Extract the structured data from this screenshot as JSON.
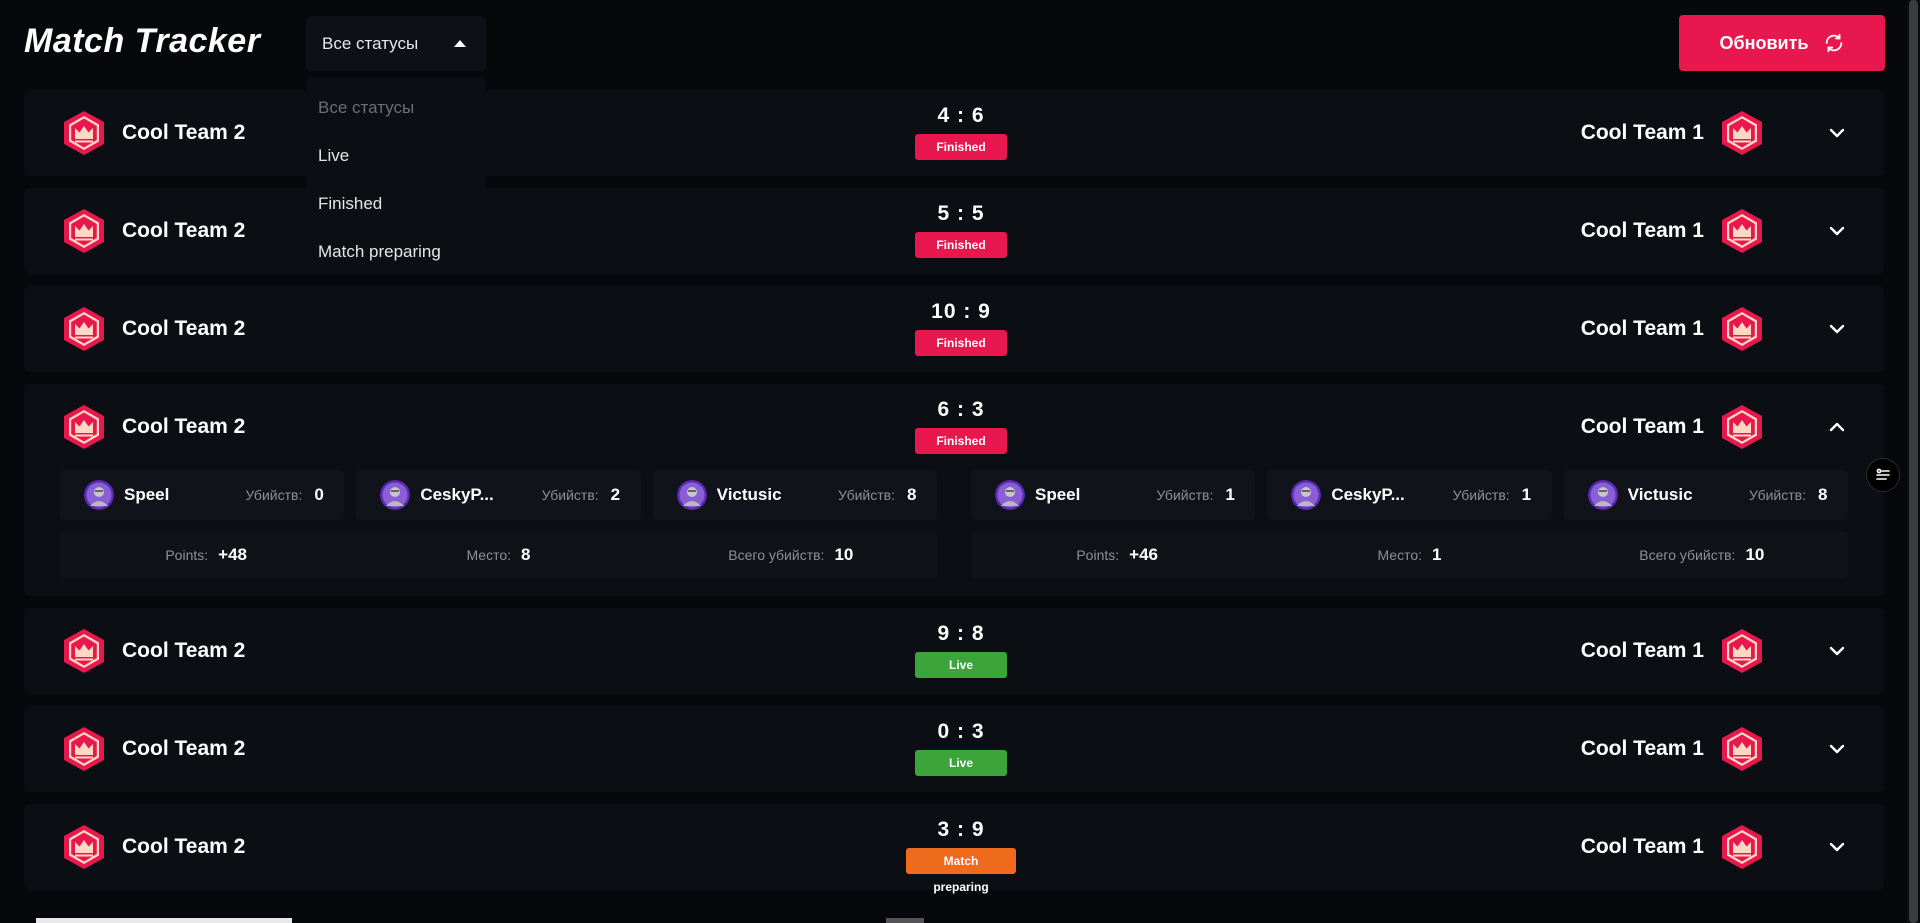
{
  "app": {
    "title": "Match Tracker"
  },
  "filter": {
    "selected": "Все статусы",
    "options": [
      "Все статусы",
      "Live",
      "Finished",
      "Match preparing"
    ]
  },
  "refresh": {
    "label": "Обновить"
  },
  "colors": {
    "accent": "#e8184e",
    "live": "#3ba53b",
    "preparing": "#ee6a1c",
    "background": "#06080c",
    "card": "#0b0e13"
  },
  "matches": [
    {
      "home": "Cool Team 2",
      "away": "Cool Team 1",
      "score": "4 : 6",
      "status": "Finished",
      "status_key": "finished",
      "expanded": false
    },
    {
      "home": "Cool Team 2",
      "away": "Cool Team 1",
      "score": "5 : 5",
      "status": "Finished",
      "status_key": "finished",
      "expanded": false
    },
    {
      "home": "Cool Team 2",
      "away": "Cool Team 1",
      "score": "10 : 9",
      "status": "Finished",
      "status_key": "finished",
      "expanded": false
    },
    {
      "home": "Cool Team 2",
      "away": "Cool Team 1",
      "score": "6 : 3",
      "status": "Finished",
      "status_key": "finished",
      "expanded": true,
      "home_details": {
        "players": [
          {
            "name": "Speel",
            "kills_label": "Убийств:",
            "kills": "0"
          },
          {
            "name": "CeskyP...",
            "kills_label": "Убийств:",
            "kills": "2"
          },
          {
            "name": "Victusic",
            "kills_label": "Убийств:",
            "kills": "8"
          }
        ],
        "stats": [
          {
            "label": "Points:",
            "value": "+48"
          },
          {
            "label": "Место:",
            "value": "8"
          },
          {
            "label": "Всего убийств:",
            "value": "10"
          }
        ]
      },
      "away_details": {
        "players": [
          {
            "name": "Speel",
            "kills_label": "Убийств:",
            "kills": "1"
          },
          {
            "name": "CeskyP...",
            "kills_label": "Убийств:",
            "kills": "1"
          },
          {
            "name": "Victusic",
            "kills_label": "Убийств:",
            "kills": "8"
          }
        ],
        "stats": [
          {
            "label": "Points:",
            "value": "+46"
          },
          {
            "label": "Место:",
            "value": "1"
          },
          {
            "label": "Всего убийств:",
            "value": "10"
          }
        ]
      }
    },
    {
      "home": "Cool Team 2",
      "away": "Cool Team 1",
      "score": "9 : 8",
      "status": "Live",
      "status_key": "live",
      "expanded": false
    },
    {
      "home": "Cool Team 2",
      "away": "Cool Team 1",
      "score": "0 : 3",
      "status": "Live",
      "status_key": "live",
      "expanded": false
    },
    {
      "home": "Cool Team 2",
      "away": "Cool Team 1",
      "score": "3 : 9",
      "status": "Match preparing",
      "status_key": "preparing",
      "expanded": false
    }
  ]
}
